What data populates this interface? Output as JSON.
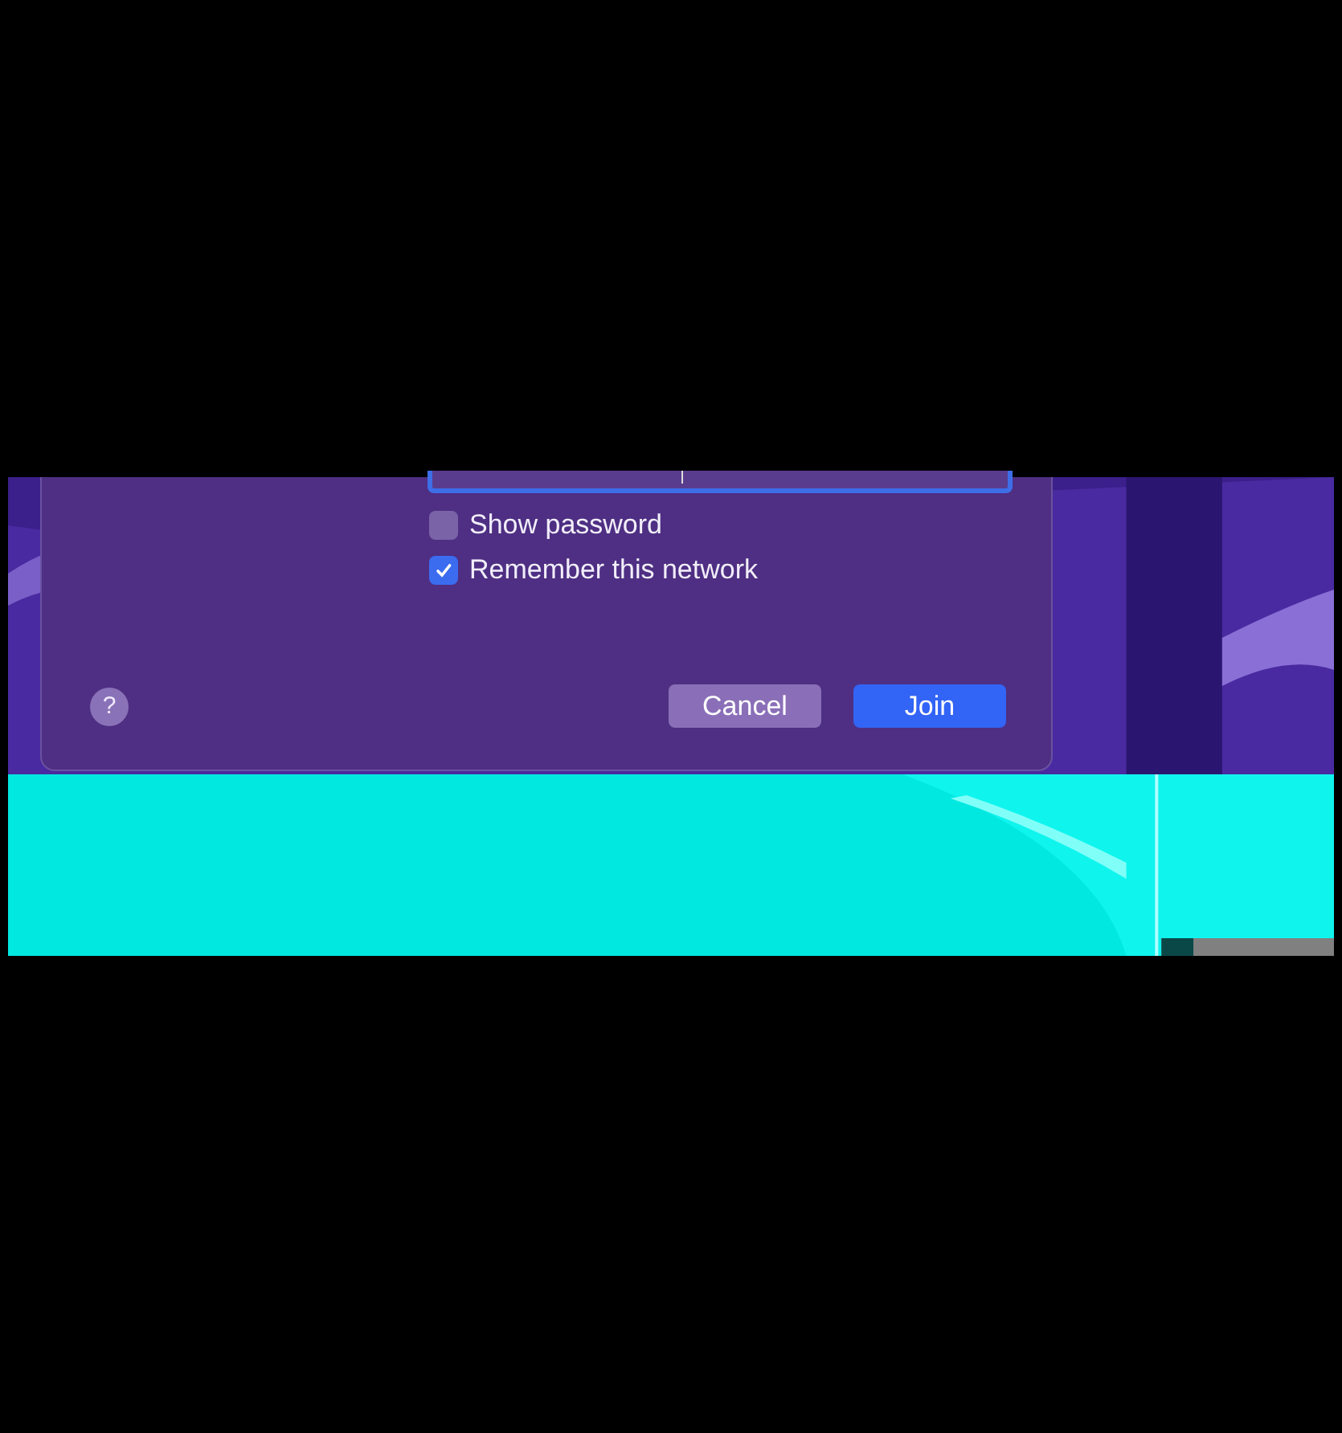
{
  "dialog": {
    "options": [
      {
        "label": "Show password",
        "checked": false
      },
      {
        "label": "Remember this network",
        "checked": true
      }
    ],
    "help": "?",
    "buttons": [
      {
        "label": "Cancel",
        "kind": "secondary"
      },
      {
        "label": "Join",
        "kind": "primary"
      }
    ]
  }
}
